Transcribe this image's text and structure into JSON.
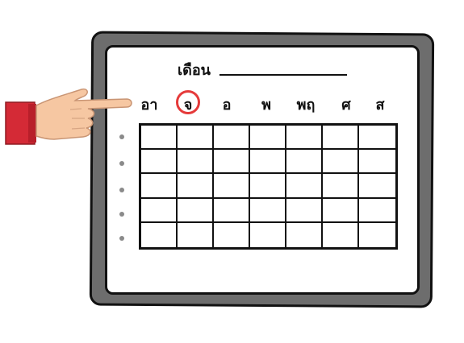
{
  "calendar": {
    "title": "เดือน",
    "days": [
      "อา",
      "จ",
      "อ",
      "พ",
      "พฤ",
      "ศ",
      "ส"
    ],
    "highlighted_day_index": 1,
    "weeks": 5,
    "highlight_color": "#e53a3a"
  },
  "icons": {
    "hand": "pointing-hand-icon"
  }
}
